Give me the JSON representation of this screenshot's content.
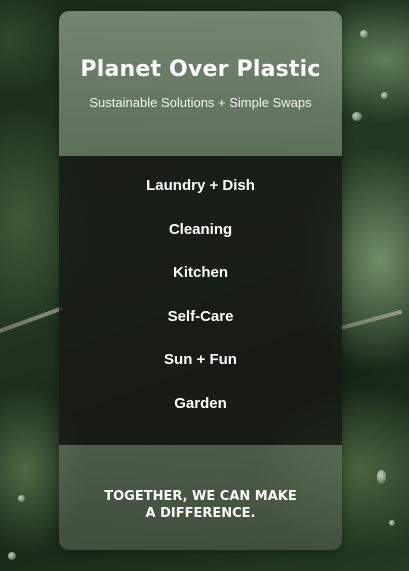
{
  "header": {
    "title": "Planet Over Plastic",
    "subtitle": "Sustainable Solutions + Simple Swaps"
  },
  "nav": {
    "items": [
      {
        "label": "Laundry + Dish"
      },
      {
        "label": "Cleaning"
      },
      {
        "label": "Kitchen"
      },
      {
        "label": "Self-Care"
      },
      {
        "label": "Sun + Fun"
      },
      {
        "label": "Garden"
      }
    ]
  },
  "footer": {
    "tagline": "TOGETHER, WE CAN MAKE A DIFFERENCE."
  }
}
